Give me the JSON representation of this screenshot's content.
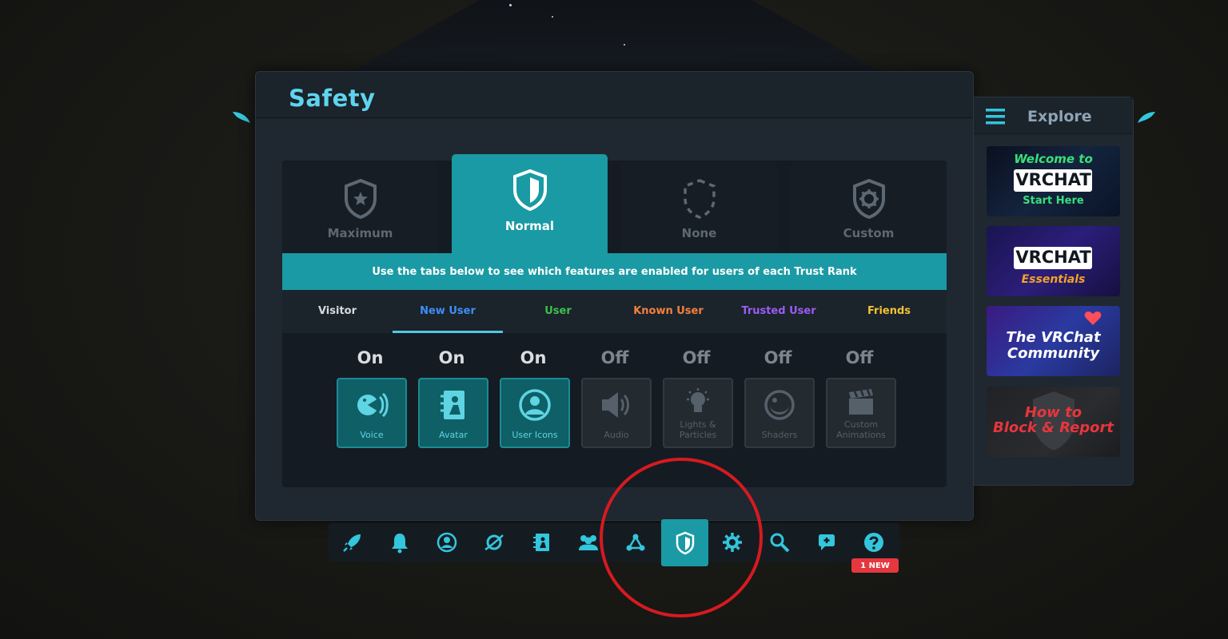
{
  "panel": {
    "title": "Safety"
  },
  "ranks": [
    {
      "label": "Maximum",
      "icon": "shield-star-icon",
      "selected": false
    },
    {
      "label": "Normal",
      "icon": "shield-icon",
      "selected": true
    },
    {
      "label": "None",
      "icon": "shield-dashed-icon",
      "selected": false
    },
    {
      "label": "Custom",
      "icon": "shield-gear-icon",
      "selected": false
    }
  ],
  "info_text": "Use the tabs below to see which features are enabled for users of each Trust Rank",
  "trust_tabs": [
    {
      "label": "Visitor",
      "color": "#d6dbe0"
    },
    {
      "label": "New User",
      "color": "#3f8ef5",
      "active": true
    },
    {
      "label": "User",
      "color": "#3ec14a"
    },
    {
      "label": "Known User",
      "color": "#f3813d"
    },
    {
      "label": "Trusted User",
      "color": "#9b5cf2"
    },
    {
      "label": "Friends",
      "color": "#f2c233"
    }
  ],
  "features": [
    {
      "status": "On",
      "label": "Voice",
      "icon": "voice-icon",
      "enabled": true
    },
    {
      "status": "On",
      "label": "Avatar",
      "icon": "avatar-icon",
      "enabled": true
    },
    {
      "status": "On",
      "label": "User Icons",
      "icon": "user-icons-icon",
      "enabled": true
    },
    {
      "status": "Off",
      "label": "Audio",
      "icon": "audio-icon",
      "enabled": false
    },
    {
      "status": "Off",
      "label_line1": "Lights &",
      "label_line2": "Particles",
      "icon": "lightbulb-icon",
      "enabled": false
    },
    {
      "status": "Off",
      "label": "Shaders",
      "icon": "shaders-icon",
      "enabled": false
    },
    {
      "status": "Off",
      "label_line1": "Custom",
      "label_line2": "Animations",
      "icon": "clapperboard-icon",
      "enabled": false
    }
  ],
  "explore": {
    "title": "Explore",
    "cards": [
      {
        "line1": "Welcome to",
        "line2": "VRCHAT",
        "line3": "Start Here"
      },
      {
        "line1": "VRCHAT",
        "line2": "Essentials"
      },
      {
        "line1": "The VRChat",
        "line2": "Community"
      },
      {
        "line1": "How to",
        "line2": "Block & Report"
      }
    ]
  },
  "toolbar": {
    "items": [
      "launch-pad-icon",
      "notifications-icon",
      "profile-icon",
      "worlds-icon",
      "avatars-icon",
      "social-icon",
      "groups-icon",
      "safety-icon",
      "settings-icon",
      "search-icon",
      "feedback-icon",
      "help-icon"
    ],
    "active": "safety-icon",
    "badge": "1 NEW"
  },
  "colors": {
    "accent": "#1a9aa4",
    "title": "#5fd4ee",
    "annotation": "#d61a20"
  }
}
